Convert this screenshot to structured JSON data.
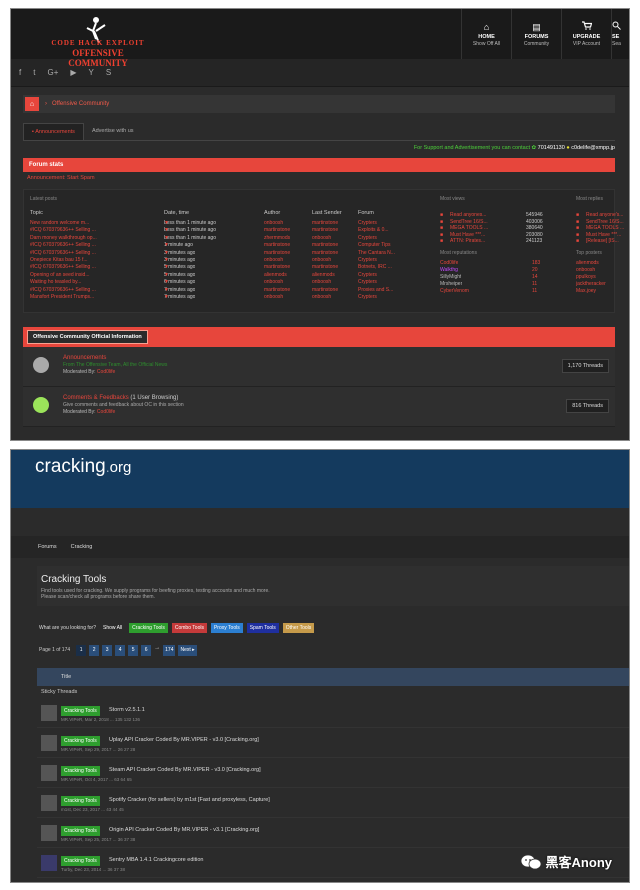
{
  "forum1": {
    "logo": {
      "line1": "CODE HACK EXPLOIT",
      "line2": "OFFENSIVE COMMUNITY"
    },
    "topnav": [
      {
        "icon": "home-icon",
        "glyph": "⌂",
        "label": "HOME",
        "sub": "Show Off All"
      },
      {
        "icon": "document-icon",
        "glyph": "▤",
        "label": "FORUMS",
        "sub": "Community"
      },
      {
        "icon": "cart-icon",
        "glyph": "🛒",
        "label": "UPGRADE",
        "sub": "VIP Account"
      },
      {
        "icon": "search-icon",
        "glyph": "",
        "label": "SE",
        "sub": "Sea"
      }
    ],
    "social": [
      "f",
      "t",
      "G+",
      "▶",
      "Y",
      "S"
    ],
    "breadcrumb": "Offensive Community",
    "tabs": [
      "Announcements",
      "Advertise with us"
    ],
    "support_text": "For Support and Advertisement you can contact",
    "support_icq": "701491130",
    "support_jabber": "c0delife@xmpp.jp",
    "forum_stats_title": "Forum stats",
    "announcement_line": "Announcement: Start Spam",
    "latest_posts_label": "Latest posts",
    "most_views_label": "Most views",
    "most_replies_label": "Most replies",
    "most_reputations_label": "Most reputations",
    "top_posters_label": "Top posters",
    "table_headers": [
      "Topic",
      "Date, time",
      "Author",
      "Last Sender",
      "Forum"
    ],
    "latest_posts": [
      {
        "topic": "New random welcome m...",
        "date": "Less than 1 minute ago",
        "author": "onboosh",
        "last": "martinstone",
        "forum": "Crypters"
      },
      {
        "topic": "#ICQ 670379636++ Selling ...",
        "date": "Less than 1 minute ago",
        "author": "martinstone",
        "last": "martinstone",
        "forum": "Exploits & 0..."
      },
      {
        "topic": "Darn money walkthrough op...",
        "date": "Less than 1 minute ago",
        "author": "zhermmods",
        "last": "onboosh",
        "forum": "Crypters"
      },
      {
        "topic": "#ICQ 670379636++ Selling ...",
        "date": "1 minute ago",
        "author": "martinstone",
        "last": "martinstone",
        "forum": "Computer Tips"
      },
      {
        "topic": "#ICQ 670379636++ Selling ...",
        "date": "3 minutes ago",
        "author": "martinstone",
        "last": "martinstone",
        "forum": "The Cantara N..."
      },
      {
        "topic": "Onepiece Kitas bau 15 f...",
        "date": "3 minutes ago",
        "author": "onboosh",
        "last": "onboosh",
        "forum": "Crypters"
      },
      {
        "topic": "#ICQ 670379636++ Selling ...",
        "date": "5 minutes ago",
        "author": "martinstone",
        "last": "martinstone",
        "forum": "Botnets, IRC ..."
      },
      {
        "topic": "Opening of an seed insid...",
        "date": "5 minutes ago",
        "author": "alienmods",
        "last": "alienmods",
        "forum": "Crypters"
      },
      {
        "topic": "Waiting ho teasled by...",
        "date": "6 minutes ago",
        "author": "onboosh",
        "last": "onboosh",
        "forum": "Crypters"
      },
      {
        "topic": "#ICQ 670379636++ Selling ...",
        "date": "7 minutes ago",
        "author": "martinstone",
        "last": "martinstone",
        "forum": "Proxies and S..."
      },
      {
        "topic": "Mansfort President Trumps...",
        "date": "7 minutes ago",
        "author": "onboosh",
        "last": "onboosh",
        "forum": "Crypters"
      }
    ],
    "most_views": [
      {
        "name": "Read anyones...",
        "val": "545946"
      },
      {
        "name": "SendTree 16/S...",
        "val": "403006"
      },
      {
        "name": "MEGA TOOLS ...",
        "val": "380640"
      },
      {
        "name": "Must Have ***...",
        "val": "203080"
      },
      {
        "name": "ATTN: Pirates...",
        "val": "241123"
      }
    ],
    "most_reps": [
      {
        "name": "Cod0life",
        "val": "183",
        "color": "#e7463c"
      },
      {
        "name": "Walkthg",
        "val": "20",
        "color": "#c24bff"
      },
      {
        "name": "SillyMight",
        "val": "14",
        "color": "#bbbbbb"
      },
      {
        "name": "Mrsheiper",
        "val": "11",
        "color": "#bbbbbb"
      },
      {
        "name": "CyberVenom",
        "val": "11",
        "color": "#e7463c"
      }
    ],
    "most_replies": [
      "Read anyone's...",
      "SendTree 16/S...",
      "MEGA TOOLS ...",
      "Must Have ***...",
      "[Release] [IS..."
    ],
    "top_posters": [
      "alienmods",
      "onboosh",
      "ppulkoys",
      "jacktheracker",
      "Max.joey"
    ],
    "section_title": "Offensive Community Official Information",
    "forums": [
      {
        "title": "Announcements",
        "desc": "From The Offensive Team, All the Official News",
        "mod_label": "Moderated By:",
        "mod": "Cod0life",
        "count": "1,170 Threads"
      },
      {
        "title": "Comments & Feedbacks",
        "viewing": "(1 User Browsing)",
        "desc": "Give comments and feedback about OC in this section",
        "mod_label": "Moderated By:",
        "mod": "Cod0life",
        "count": "816 Threads"
      }
    ]
  },
  "forum2": {
    "logo_main": "cracking",
    "logo_dot": ".",
    "logo_org": "org",
    "crumbs": [
      "Forums",
      "Cracking"
    ],
    "title": "Cracking Tools",
    "desc_line1": "Find tools used for cracking. We supply programs for beefing proxies, testing accounts and much more.",
    "desc_line2": "Please scan/check all programs before share them.",
    "filter_label": "What are you looking for?",
    "filters": [
      {
        "label": "Show All",
        "bg": "#2b2b2b",
        "fg": "#ffffff"
      },
      {
        "label": "Cracking Tools",
        "bg": "#2e9e2e",
        "fg": "#ffffff"
      },
      {
        "label": "Combo Tools",
        "bg": "#c43a3a",
        "fg": "#ffffff"
      },
      {
        "label": "Proxy Tools",
        "bg": "#2c7fd1",
        "fg": "#ffffff"
      },
      {
        "label": "Spam Tools",
        "bg": "#1f2f9f",
        "fg": "#ffffff"
      },
      {
        "label": "Other Tools",
        "bg": "#c59a4a",
        "fg": "#ffffff"
      }
    ],
    "page_label": "Page 1 of 174",
    "pages": [
      "1",
      "2",
      "3",
      "4",
      "5",
      "6",
      "→",
      "174",
      "Next ▸"
    ],
    "title_col": "Title",
    "sticky_label": "Sticky Threads",
    "threads": [
      {
        "tag": "Cracking Tools",
        "title": "Storm v2.5.1.1",
        "meta": "MR.VIPeR, Mar 2, 2018  ... 135  132  136"
      },
      {
        "tag": "Cracking Tools",
        "title": "Uplay API Cracker Coded By MR.VIPER - v3.0 [Cracking.org]",
        "meta": "MR.VIPeR, Sep 29, 2017  ... 26  27  28"
      },
      {
        "tag": "Cracking Tools",
        "title": "Steam API Cracker Coded By MR.VIPER - v3.0 [Cracking.org]",
        "meta": "MR.VIPeR, Oct 4, 2017  ... 63  64  65"
      },
      {
        "tag": "Cracking Tools",
        "title": "Spotify Cracker (for sellers) by m1st [Fast and proxyless, Capture]",
        "meta": "m1st, Dec 23, 2017  ... 43  44  45"
      },
      {
        "tag": "Cracking Tools",
        "title": "Origin API Cracker Coded By MR.VIPER - v3.1 [Cracking.org]",
        "meta": "MR.VIPeR, Sep 25, 2017  ... 36  37  38"
      },
      {
        "tag": "Cracking Tools",
        "title": "Sentry MBA 1.4.1 Crackingcore edition",
        "meta": "Turby, Dec 23, 2014  ... 36  37  38"
      }
    ]
  },
  "watermark": "黑客Anony"
}
